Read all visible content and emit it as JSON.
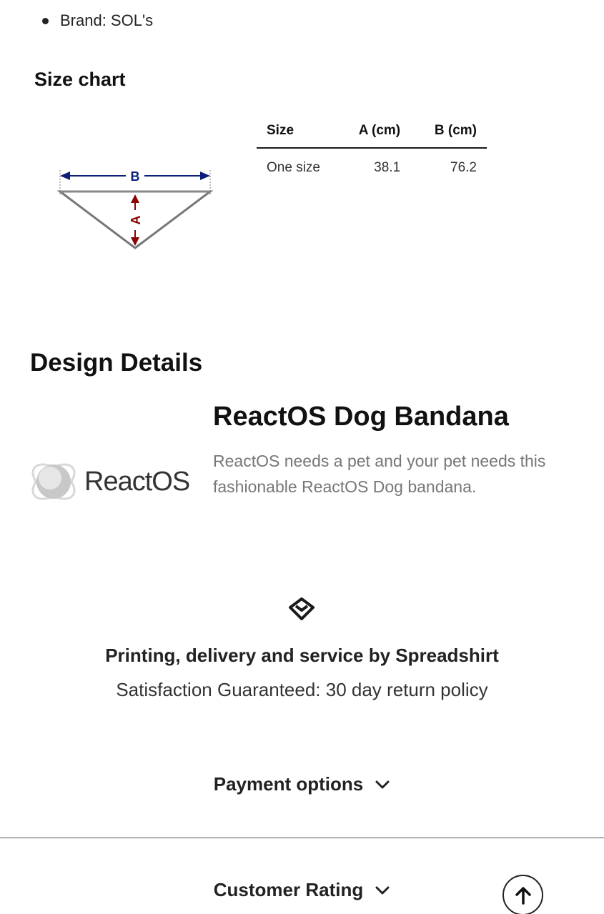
{
  "product_info": {
    "brand": "Brand: SOL's"
  },
  "size_chart": {
    "title": "Size chart",
    "diagram_labels": {
      "width_label": "B",
      "height_label": "A"
    },
    "columns": [
      "Size",
      "A (cm)",
      "B (cm)"
    ],
    "rows": [
      {
        "size": "One size",
        "a": "38.1",
        "b": "76.2"
      }
    ]
  },
  "design_details": {
    "heading": "Design Details",
    "logo_text": "ReactOS",
    "name": "ReactOS Dog Bandana",
    "description": "ReactOS needs a pet and your pet needs this fashionable ReactOS Dog bandana."
  },
  "service": {
    "icon": "diamond-heart-icon",
    "title": "Printing, delivery and service by Spreadshirt",
    "subtitle": "Satisfaction Guaranteed: 30 day return policy"
  },
  "accordions": {
    "payment_label": "Payment options",
    "rating_label": "Customer Rating"
  },
  "colors": {
    "diagram_arrow_blue": "#0b1f7a",
    "diagram_arrow_red": "#8b0000",
    "diagram_outline": "#777777"
  }
}
